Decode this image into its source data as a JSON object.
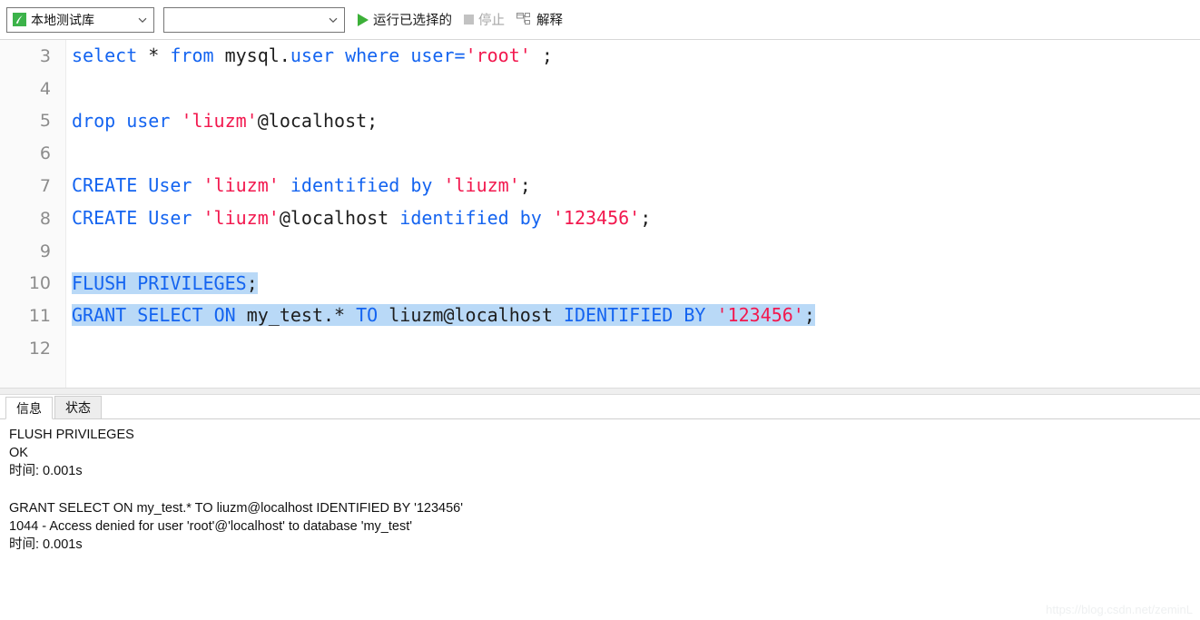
{
  "toolbar": {
    "db_combo": {
      "value": "本地测试库",
      "icon": "database-icon",
      "chevron": "chevron-down-icon"
    },
    "object_combo": {
      "value": "",
      "placeholder": "",
      "chevron": "chevron-down-icon"
    },
    "run_selected": {
      "label": "运行已选择的",
      "icon": "play-icon"
    },
    "stop": {
      "label": "停止",
      "icon": "stop-icon",
      "disabled": true
    },
    "explain": {
      "label": "解释",
      "icon": "explain-tree-icon"
    }
  },
  "editor": {
    "first_line_number": 3,
    "lines": [
      {
        "n": 3,
        "selected": false,
        "tokens": [
          {
            "t": "select",
            "c": "kw"
          },
          {
            "t": " ",
            "c": "pl"
          },
          {
            "t": "*",
            "c": "pl"
          },
          {
            "t": " ",
            "c": "pl"
          },
          {
            "t": "from",
            "c": "kw"
          },
          {
            "t": " mysql.",
            "c": "pl"
          },
          {
            "t": "user",
            "c": "kw"
          },
          {
            "t": " ",
            "c": "pl"
          },
          {
            "t": "where",
            "c": "kw"
          },
          {
            "t": " ",
            "c": "pl"
          },
          {
            "t": "user=",
            "c": "kw"
          },
          {
            "t": "'root'",
            "c": "str"
          },
          {
            "t": " ;",
            "c": "pl"
          }
        ]
      },
      {
        "n": 4,
        "selected": false,
        "tokens": []
      },
      {
        "n": 5,
        "selected": false,
        "tokens": [
          {
            "t": "drop",
            "c": "kw"
          },
          {
            "t": " ",
            "c": "pl"
          },
          {
            "t": "user",
            "c": "kw"
          },
          {
            "t": " ",
            "c": "pl"
          },
          {
            "t": "'liuzm'",
            "c": "str"
          },
          {
            "t": "@localhost;",
            "c": "pl"
          }
        ]
      },
      {
        "n": 6,
        "selected": false,
        "tokens": []
      },
      {
        "n": 7,
        "selected": false,
        "tokens": [
          {
            "t": "CREATE",
            "c": "kw"
          },
          {
            "t": " ",
            "c": "pl"
          },
          {
            "t": "User",
            "c": "kw"
          },
          {
            "t": " ",
            "c": "pl"
          },
          {
            "t": "'liuzm'",
            "c": "str"
          },
          {
            "t": " ",
            "c": "pl"
          },
          {
            "t": "identified",
            "c": "kw"
          },
          {
            "t": " ",
            "c": "pl"
          },
          {
            "t": "by",
            "c": "kw"
          },
          {
            "t": " ",
            "c": "pl"
          },
          {
            "t": "'liuzm'",
            "c": "str"
          },
          {
            "t": ";",
            "c": "pl"
          }
        ]
      },
      {
        "n": 8,
        "selected": false,
        "tokens": [
          {
            "t": "CREATE",
            "c": "kw"
          },
          {
            "t": " ",
            "c": "pl"
          },
          {
            "t": "User",
            "c": "kw"
          },
          {
            "t": " ",
            "c": "pl"
          },
          {
            "t": "'liuzm'",
            "c": "str"
          },
          {
            "t": "@localhost",
            "c": "pl"
          },
          {
            "t": " ",
            "c": "pl"
          },
          {
            "t": "identified",
            "c": "kw"
          },
          {
            "t": " ",
            "c": "pl"
          },
          {
            "t": "by",
            "c": "kw"
          },
          {
            "t": " ",
            "c": "pl"
          },
          {
            "t": "'123456'",
            "c": "str"
          },
          {
            "t": ";",
            "c": "pl"
          }
        ]
      },
      {
        "n": 9,
        "selected": false,
        "tokens": []
      },
      {
        "n": 10,
        "selected": true,
        "tokens": [
          {
            "t": "FLUSH",
            "c": "kw"
          },
          {
            "t": " ",
            "c": "pl"
          },
          {
            "t": "PRIVILEGES",
            "c": "kw"
          },
          {
            "t": ";",
            "c": "pl"
          }
        ]
      },
      {
        "n": 11,
        "selected": true,
        "tokens": [
          {
            "t": "GRANT",
            "c": "kw"
          },
          {
            "t": " ",
            "c": "pl"
          },
          {
            "t": "SELECT",
            "c": "kw"
          },
          {
            "t": " ",
            "c": "pl"
          },
          {
            "t": "ON",
            "c": "kw"
          },
          {
            "t": " my_test.* ",
            "c": "pl"
          },
          {
            "t": "TO",
            "c": "kw"
          },
          {
            "t": " liuzm@localhost ",
            "c": "pl"
          },
          {
            "t": "IDENTIFIED",
            "c": "kw"
          },
          {
            "t": " ",
            "c": "pl"
          },
          {
            "t": "BY",
            "c": "kw"
          },
          {
            "t": " ",
            "c": "pl"
          },
          {
            "t": "'123456'",
            "c": "str"
          },
          {
            "t": ";",
            "c": "pl"
          }
        ]
      },
      {
        "n": 12,
        "selected": false,
        "tokens": []
      }
    ]
  },
  "result_panel": {
    "tabs": [
      {
        "label": "信息",
        "active": true
      },
      {
        "label": "状态",
        "active": false
      }
    ],
    "log_blocks": [
      {
        "lines": [
          "FLUSH PRIVILEGES",
          "OK",
          "时间: 0.001s"
        ]
      },
      {
        "lines": [
          "GRANT SELECT ON my_test.* TO liuzm@localhost IDENTIFIED BY '123456'",
          "1044 - Access denied for user 'root'@'localhost' to database 'my_test'",
          "时间: 0.001s"
        ]
      }
    ]
  },
  "watermark": {
    "text": "https://blog.csdn.net/zeminL"
  },
  "colors": {
    "keyword": "#1464f0",
    "string": "#f2184e",
    "plain": "#1e1e1e",
    "selection": "#b9d9f7",
    "play_green": "#3cb038",
    "gutter_number": "#8c8c8c",
    "disabled_text": "#a6a6a6"
  }
}
